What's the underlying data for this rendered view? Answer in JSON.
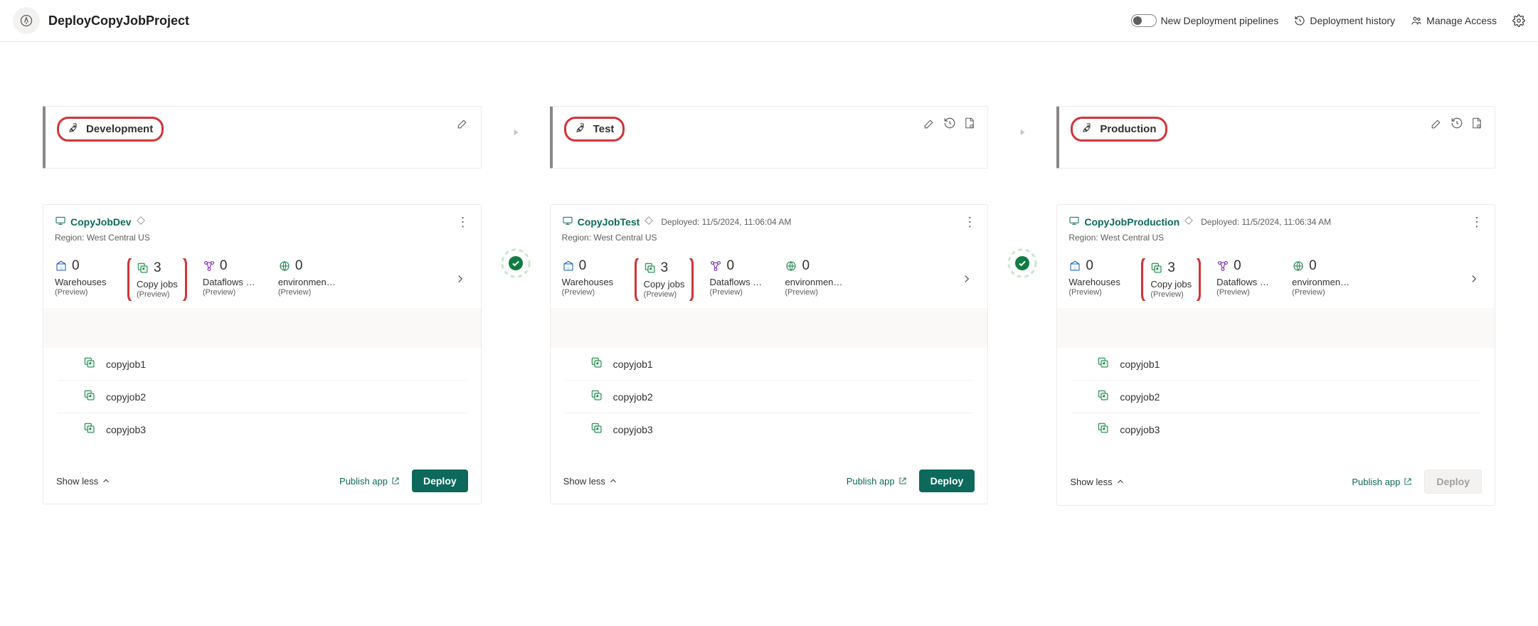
{
  "header": {
    "title": "DeployCopyJobProject",
    "nav": {
      "new_pipelines": "New Deployment pipelines",
      "history": "Deployment history",
      "manage_access": "Manage Access"
    }
  },
  "stages": [
    {
      "name": "Development",
      "actions": [
        "edit"
      ],
      "workspace": {
        "name": "CopyJobDev",
        "deployed": "",
        "region": "Region: West Central US",
        "stats": [
          {
            "icon": "warehouse",
            "value": "0",
            "label": "Warehouses",
            "preview": "(Preview)",
            "highlight": false
          },
          {
            "icon": "copyjob",
            "value": "3",
            "label": "Copy jobs",
            "preview": "(Preview)",
            "highlight": true
          },
          {
            "icon": "dataflow",
            "value": "0",
            "label": "Dataflows …",
            "preview": "(Preview)",
            "highlight": false
          },
          {
            "icon": "env",
            "value": "0",
            "label": "environmen…",
            "preview": "(Preview)",
            "highlight": false
          }
        ],
        "items": [
          "copyjob1",
          "copyjob2",
          "copyjob3"
        ],
        "show_less": "Show less",
        "publish": "Publish app",
        "deploy": "Deploy",
        "deploy_enabled": true
      }
    },
    {
      "name": "Test",
      "actions": [
        "edit",
        "history",
        "rules"
      ],
      "workspace": {
        "name": "CopyJobTest",
        "deployed": "Deployed: 11/5/2024, 11:06:04 AM",
        "region": "Region: West Central US",
        "stats": [
          {
            "icon": "warehouse",
            "value": "0",
            "label": "Warehouses",
            "preview": "(Preview)",
            "highlight": false
          },
          {
            "icon": "copyjob",
            "value": "3",
            "label": "Copy jobs",
            "preview": "(Preview)",
            "highlight": true
          },
          {
            "icon": "dataflow",
            "value": "0",
            "label": "Dataflows …",
            "preview": "(Preview)",
            "highlight": false
          },
          {
            "icon": "env",
            "value": "0",
            "label": "environmen…",
            "preview": "(Preview)",
            "highlight": false
          }
        ],
        "items": [
          "copyjob1",
          "copyjob2",
          "copyjob3"
        ],
        "show_less": "Show less",
        "publish": "Publish app",
        "deploy": "Deploy",
        "deploy_enabled": true
      }
    },
    {
      "name": "Production",
      "actions": [
        "edit",
        "history",
        "rules"
      ],
      "workspace": {
        "name": "CopyJobProduction",
        "deployed": "Deployed: 11/5/2024, 11:06:34 AM",
        "region": "Region: West Central US",
        "stats": [
          {
            "icon": "warehouse",
            "value": "0",
            "label": "Warehouses",
            "preview": "(Preview)",
            "highlight": false
          },
          {
            "icon": "copyjob",
            "value": "3",
            "label": "Copy jobs",
            "preview": "(Preview)",
            "highlight": true
          },
          {
            "icon": "dataflow",
            "value": "0",
            "label": "Dataflows …",
            "preview": "(Preview)",
            "highlight": false
          },
          {
            "icon": "env",
            "value": "0",
            "label": "environmen…",
            "preview": "(Preview)",
            "highlight": false
          }
        ],
        "items": [
          "copyjob1",
          "copyjob2",
          "copyjob3"
        ],
        "show_less": "Show less",
        "publish": "Publish app",
        "deploy": "Deploy",
        "deploy_enabled": false
      }
    }
  ]
}
